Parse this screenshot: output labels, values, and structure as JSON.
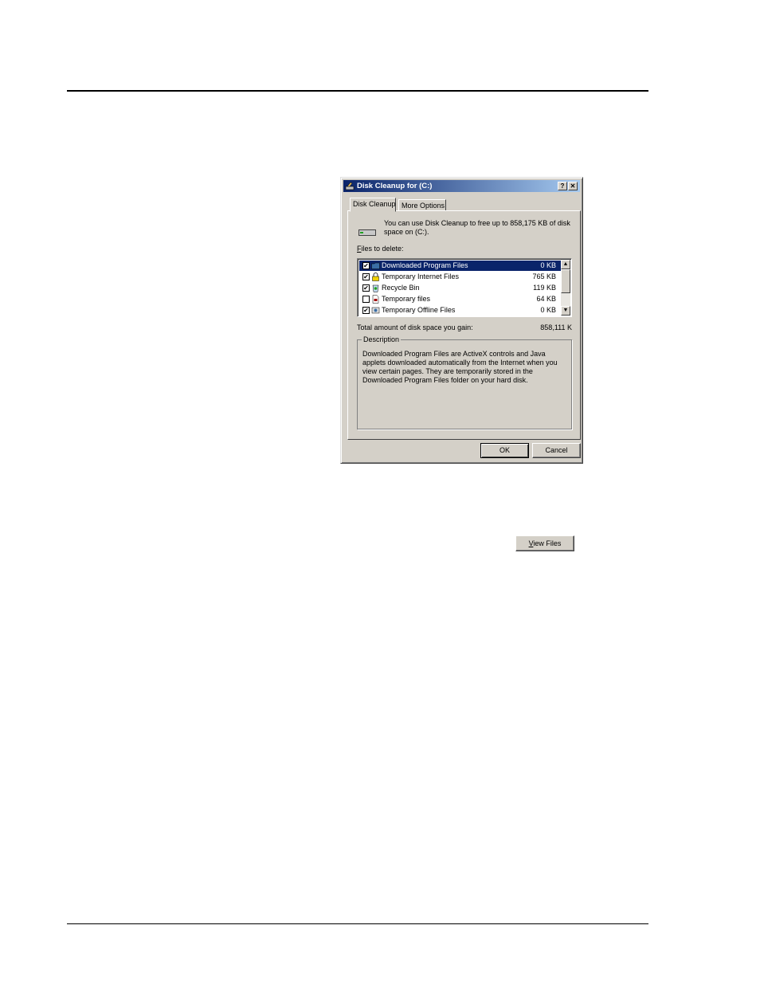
{
  "dialog": {
    "title": "Disk Cleanup for  (C:)",
    "help_button": "?",
    "close_button": "✕"
  },
  "tabs": [
    {
      "label": "Disk Cleanup",
      "active": true
    },
    {
      "label": "More Options",
      "active": false
    }
  ],
  "intro_text": "You can use Disk Cleanup to free up to 858,175 KB of disk space on  (C:).",
  "files_label_access": "F",
  "files_label_rest": "iles to delete:",
  "files": [
    {
      "name": "Downloaded Program Files",
      "size": "0 KB",
      "checked": true,
      "selected": true,
      "icon": "folder-icon"
    },
    {
      "name": "Temporary Internet Files",
      "size": "765 KB",
      "checked": true,
      "selected": false,
      "icon": "lock-icon"
    },
    {
      "name": "Recycle Bin",
      "size": "119 KB",
      "checked": true,
      "selected": false,
      "icon": "recycle-bin-icon"
    },
    {
      "name": "Temporary files",
      "size": "64 KB",
      "checked": false,
      "selected": false,
      "icon": "file-icon"
    },
    {
      "name": "Temporary Offline Files",
      "size": "0 KB",
      "checked": true,
      "selected": false,
      "icon": "offline-files-icon"
    }
  ],
  "total_label": "Total amount of disk space you gain:",
  "total_value": "858,111 K",
  "description": {
    "legend": "Description",
    "text": "Downloaded Program Files are ActiveX controls and Java applets downloaded automatically from the Internet when you view certain pages. They are temporarily stored in the Downloaded Program Files folder on your hard disk."
  },
  "buttons": {
    "view_files_access": "V",
    "view_files_rest": "iew Files",
    "ok": "OK",
    "cancel": "Cancel"
  },
  "check_mark": "✔",
  "scroll_up": "▲",
  "scroll_down": "▼",
  "colors": {
    "face": "#d4d0c8",
    "title_start": "#0a246a",
    "title_end": "#a6caf0",
    "selection": "#0a246a"
  }
}
